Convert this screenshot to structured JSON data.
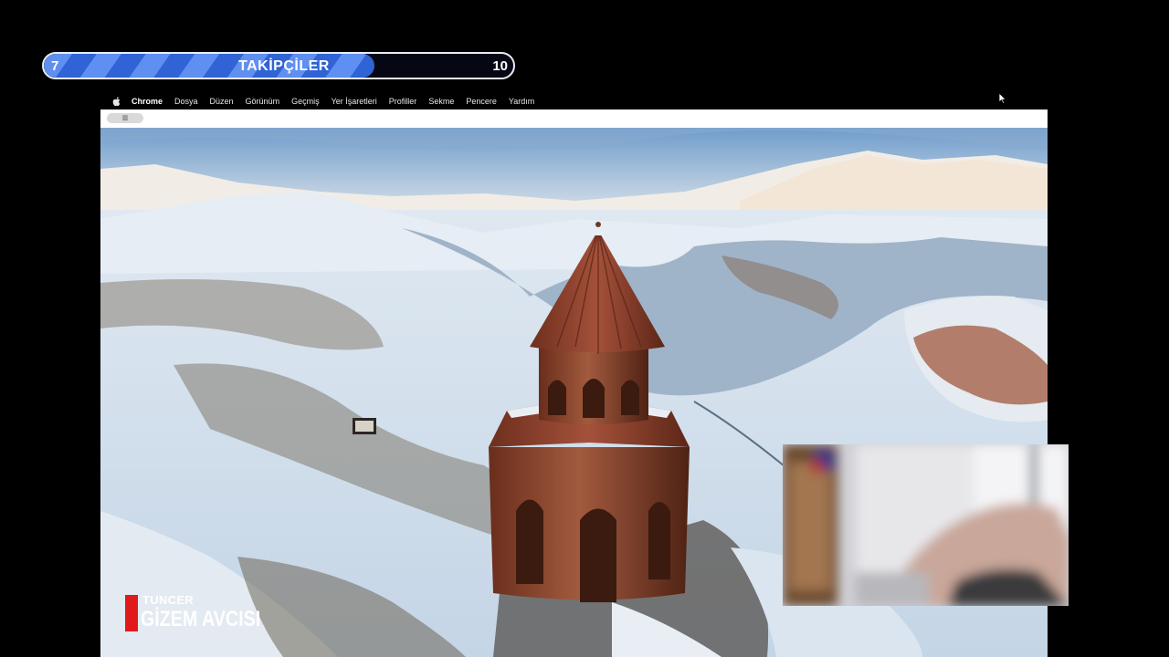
{
  "goal": {
    "current": "7",
    "title": "TAKİPÇİLER",
    "target": "10",
    "progress": 0.7
  },
  "menubar": {
    "app": "Chrome",
    "items": [
      "Dosya",
      "Düzen",
      "Görünüm",
      "Geçmiş",
      "Yer İşaretleri",
      "Profiller",
      "Sekme",
      "Pencere",
      "Yardım"
    ]
  },
  "browser": {
    "tab_label": "▥"
  },
  "logo": {
    "small": "TUNCER",
    "big": "GİZEM AVCISI"
  },
  "colors": {
    "goal_fill": "#3f73e0",
    "logo_red": "#e01a1a"
  }
}
